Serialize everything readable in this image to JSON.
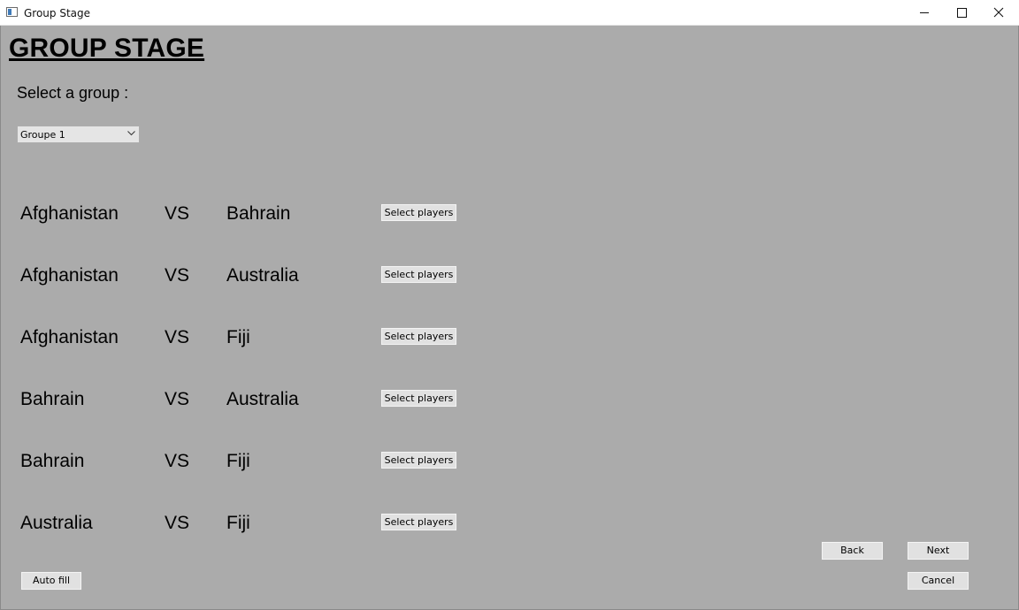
{
  "window": {
    "title": "Group Stage"
  },
  "header": {
    "heading": "GROUP STAGE"
  },
  "group_select": {
    "label": "Select a group :",
    "selected": "Groupe 1"
  },
  "matches": [
    {
      "team_a": "Afghanistan",
      "vs": "VS",
      "team_b": "Bahrain",
      "button": "Select players"
    },
    {
      "team_a": "Afghanistan",
      "vs": "VS",
      "team_b": "Australia",
      "button": "Select players"
    },
    {
      "team_a": "Afghanistan",
      "vs": "VS",
      "team_b": "Fiji",
      "button": "Select players"
    },
    {
      "team_a": "Bahrain",
      "vs": "VS",
      "team_b": "Australia",
      "button": "Select players"
    },
    {
      "team_a": "Bahrain",
      "vs": "VS",
      "team_b": "Fiji",
      "button": "Select players"
    },
    {
      "team_a": "Australia",
      "vs": "VS",
      "team_b": "Fiji",
      "button": "Select players"
    }
  ],
  "footer": {
    "auto_fill": "Auto fill",
    "back": "Back",
    "next": "Next",
    "cancel": "Cancel"
  },
  "icons": {
    "app": "app-window-icon",
    "minimize": "minimize-icon",
    "maximize": "maximize-icon",
    "close": "close-icon",
    "dropdown": "chevron-down-icon"
  },
  "colors": {
    "background": "#ababab",
    "titlebar": "#ffffff",
    "button": "#e1e1e1"
  }
}
